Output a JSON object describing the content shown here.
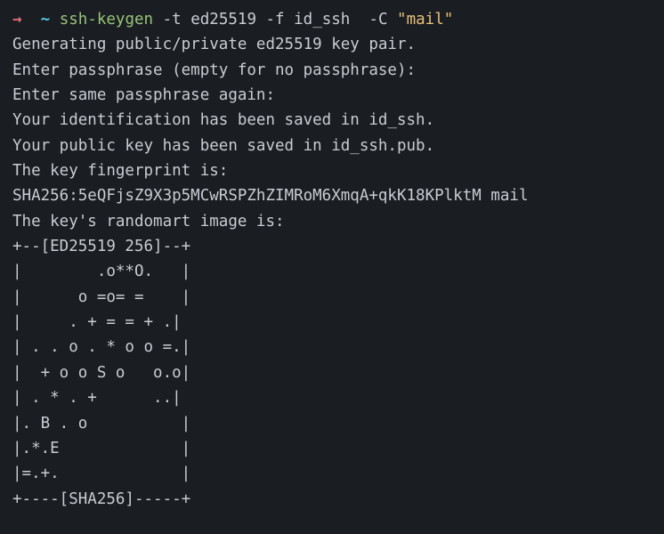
{
  "prompt": {
    "arrow": "→",
    "dir": "~",
    "cmd": "ssh-keygen",
    "args": "-t ed25519 -f id_ssh  -C",
    "quoted": "\"mail\""
  },
  "output": {
    "line1": "Generating public/private ed25519 key pair.",
    "line2": "Enter passphrase (empty for no passphrase):",
    "line3": "Enter same passphrase again:",
    "line4": "Your identification has been saved in id_ssh.",
    "line5": "Your public key has been saved in id_ssh.pub.",
    "line6": "The key fingerprint is:",
    "line7": "SHA256:5eQFjsZ9X3p5MCwRSPZhZIMRoM6XmqA+qkK18KPlktM mail",
    "line8": "The key's randomart image is:",
    "art01": "+--[ED25519 256]--+",
    "art02": "|        .o**O.   |",
    "art03": "|      o =o= =    |",
    "art04": "|     . + = = + .|",
    "art05": "| . . o . * o o =.|",
    "art06": "|  + o o S o   o.o|",
    "art07": "| . * . +      ..|",
    "art08": "|. B . o          |",
    "art09": "|.*.E             |",
    "art10": "|=.+.             |",
    "art11": "+----[SHA256]-----+"
  }
}
